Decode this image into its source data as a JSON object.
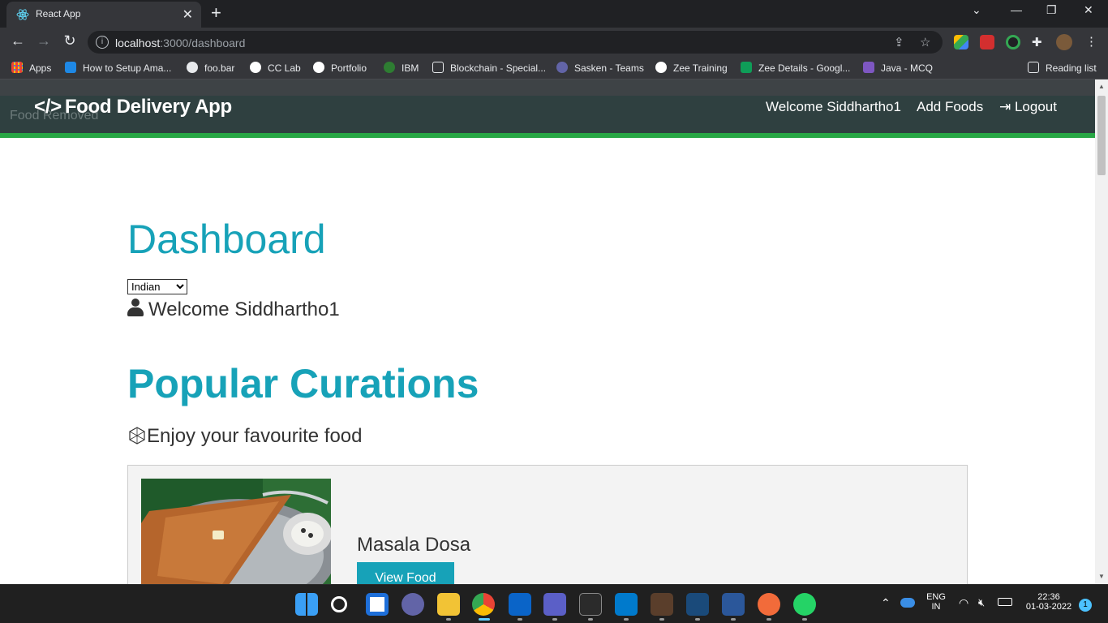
{
  "browser": {
    "tab_title": "React App",
    "url_host": "localhost",
    "url_rest": ":3000/dashboard",
    "bookmarks": [
      {
        "label": "Apps",
        "color": "#ea4335"
      },
      {
        "label": "How to Setup Ama...",
        "color": "#1e88e5"
      },
      {
        "label": "foo.bar",
        "color": "#ffffff"
      },
      {
        "label": "CC Lab",
        "color": "#ffffff"
      },
      {
        "label": "Portfolio",
        "color": "#ffffff"
      },
      {
        "label": "IBM",
        "color": "#2e7d32"
      },
      {
        "label": "Blockchain - Special...",
        "color": "#ffffff"
      },
      {
        "label": "Sasken - Teams",
        "color": "#6264a7"
      },
      {
        "label": "Zee Training",
        "color": "#ffffff"
      },
      {
        "label": "Zee Details - Googl...",
        "color": "#0f9d58"
      },
      {
        "label": "Java - MCQ",
        "color": "#7e57c2"
      }
    ],
    "reading_list": "Reading list"
  },
  "app": {
    "ghost_text": "Food Removed",
    "brand": "Food Delivery App",
    "brand_icon": "</>",
    "nav": {
      "welcome": "Welcome Siddhartho1",
      "add_foods": "Add Foods",
      "logout": "Logout"
    },
    "dashboard_title": "Dashboard",
    "cuisine_selected": "Indian",
    "welcome_text": "Welcome Siddhartho1",
    "popular_title": "Popular Curations",
    "enjoy_text": "Enjoy your favourite food",
    "food": {
      "name": "Masala Dosa",
      "button": "View Food"
    },
    "accent_color": "#17a2b8",
    "green_color": "#28a745"
  },
  "taskbar": {
    "lang_top": "ENG",
    "lang_bottom": "IN",
    "time": "22:36",
    "date": "01-03-2022",
    "notifications": "1"
  }
}
